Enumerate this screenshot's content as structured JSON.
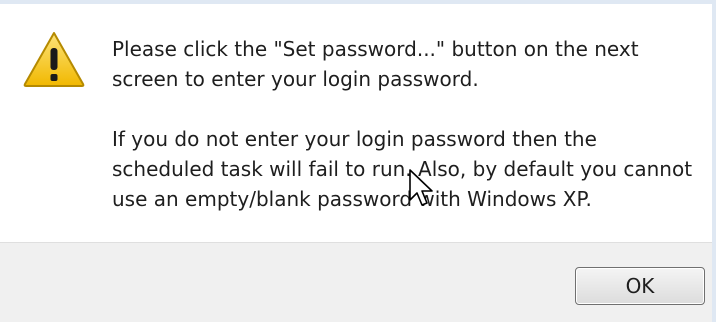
{
  "message": {
    "paragraph1": "Please click the \"Set password...\" button on the next screen to enter your login password.",
    "paragraph2": "If you do not enter your login password then the scheduled task will fail to run. Also, by default you cannot use an empty/blank password with Windows XP."
  },
  "buttons": {
    "ok_label": "OK"
  },
  "icons": {
    "warning": "warning-icon",
    "cursor": "mouse-pointer-icon"
  },
  "colors": {
    "dialog_background": "#ffffff",
    "footer_background": "#f0f0f0",
    "warning_yellow": "#f5c400",
    "text": "#1e1e1e"
  }
}
